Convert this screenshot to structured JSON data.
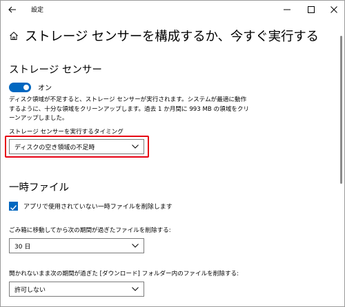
{
  "window": {
    "app_title": "設定",
    "controls": {
      "minimize": "minimize-icon",
      "maximize": "maximize-icon",
      "close": "close-icon"
    }
  },
  "page": {
    "title": "ストレージ センサーを構成するか、今すぐ実行する"
  },
  "storage_sense": {
    "heading": "ストレージ センサー",
    "toggle_state": "オン",
    "description": "ディスク領域が不足すると、ストレージ センサーが実行されます。システムが最適に動作するように、十分な領域をクリーンアップします。過去 1 か月間に 993 MB の領域をクリーンアップしました。",
    "timing_label": "ストレージ センサーを実行するタイミング",
    "timing_value": "ディスクの空き領域の不足時"
  },
  "temp_files": {
    "heading": "一時ファイル",
    "delete_temp_label": "アプリで使用されていない一時ファイルを削除します",
    "delete_temp_checked": true,
    "recycle_label": "ごみ箱に移動してから次の期間が過ぎたファイルを削除する:",
    "recycle_value": "30 日",
    "downloads_label": "開かれないまま次の期間が過ぎた [ダウンロード] フォルダー内のファイルを削除する:",
    "downloads_value": "許可しない"
  },
  "colors": {
    "accent": "#0067c0",
    "highlight": "#e60012"
  }
}
